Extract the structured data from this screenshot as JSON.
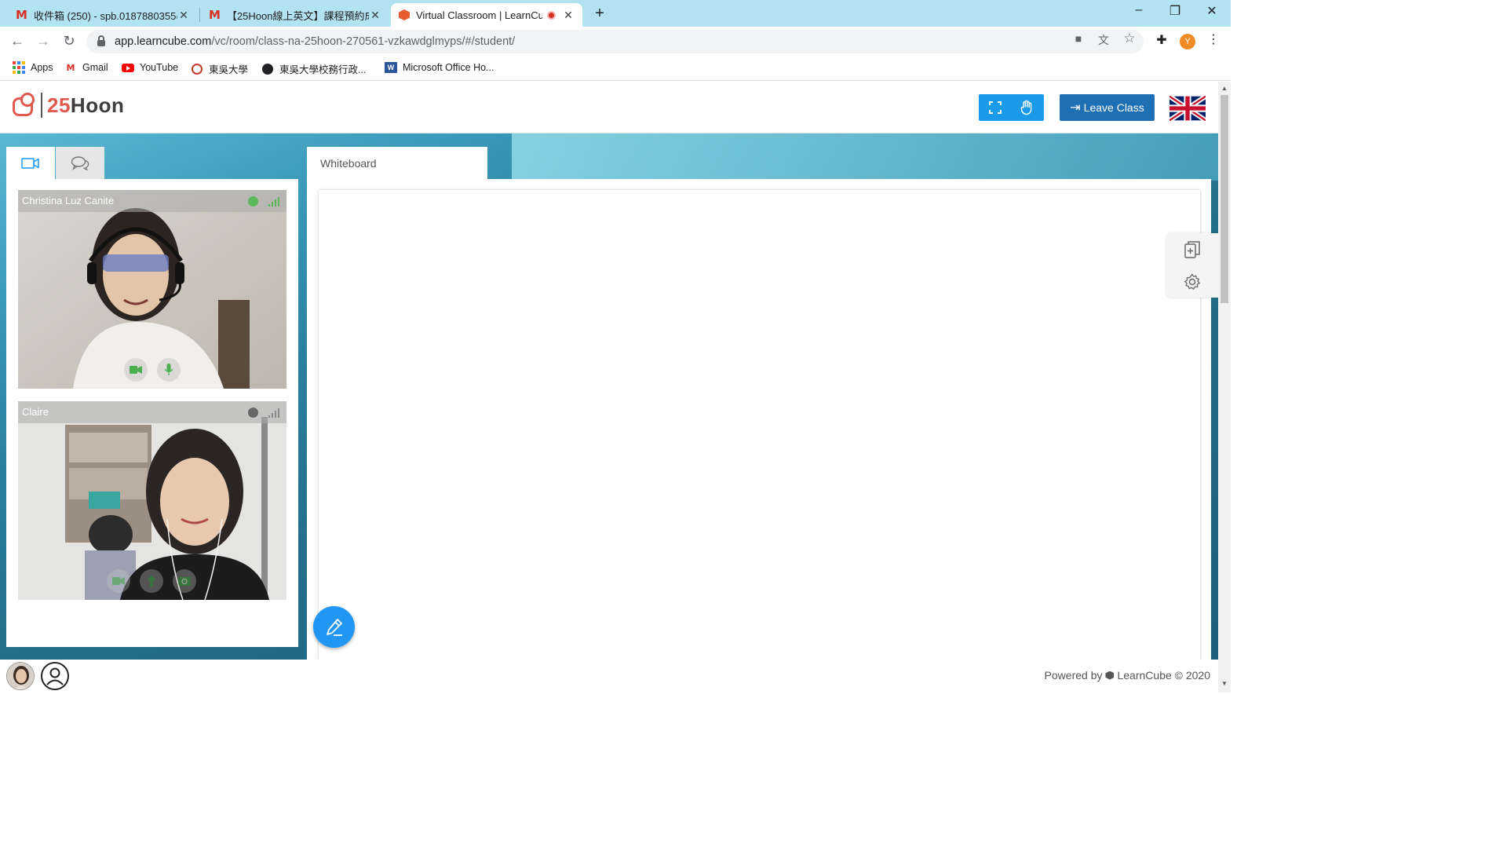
{
  "browser": {
    "tabs": [
      {
        "title": "收件箱 (250) - spb.0187880355@",
        "active": false
      },
      {
        "title": "【25Hoon線上英文】課程預約成功",
        "active": false
      },
      {
        "title": "Virtual Classroom | LearnCub",
        "active": true
      }
    ],
    "url_host": "app.learncube.com",
    "url_path": "/vc/room/class-na-25hoon-270561-vzkawdglmyps/#/student/",
    "profile_initial": "Y",
    "bookmarks": [
      {
        "label": "Apps",
        "icon": "apps-grid-icon"
      },
      {
        "label": "Gmail",
        "icon": "gmail-icon"
      },
      {
        "label": "YouTube",
        "icon": "youtube-icon"
      },
      {
        "label": "東吳大學",
        "icon": "university-seal-icon"
      },
      {
        "label": "東吳大學校務行政...",
        "icon": "globe-icon"
      },
      {
        "label": "Microsoft Office Ho...",
        "icon": "word-icon"
      }
    ]
  },
  "header": {
    "logo_number": "25",
    "logo_word": "Hoon",
    "leave_label": "Leave Class",
    "language": "English (UK flag)"
  },
  "panel": {
    "tabs": [
      {
        "icon": "video-camera-icon",
        "active": true
      },
      {
        "icon": "chat-icon",
        "active": false
      }
    ],
    "participants": [
      {
        "name": "Christina Luz Canite",
        "online": true,
        "status_color": "#5cb85c"
      },
      {
        "name": "Claire",
        "online": false,
        "status_color": "#666666"
      }
    ]
  },
  "whiteboard": {
    "tab_label": "Whiteboard"
  },
  "footer": {
    "powered_prefix": "Powered by",
    "powered_brand": "LearnCube © 2020"
  },
  "colors": {
    "primary_blue": "#1a9ae8",
    "leave_blue": "#1f6fb4",
    "brand_red": "#e05a4f",
    "fab_blue": "#2196f3"
  }
}
